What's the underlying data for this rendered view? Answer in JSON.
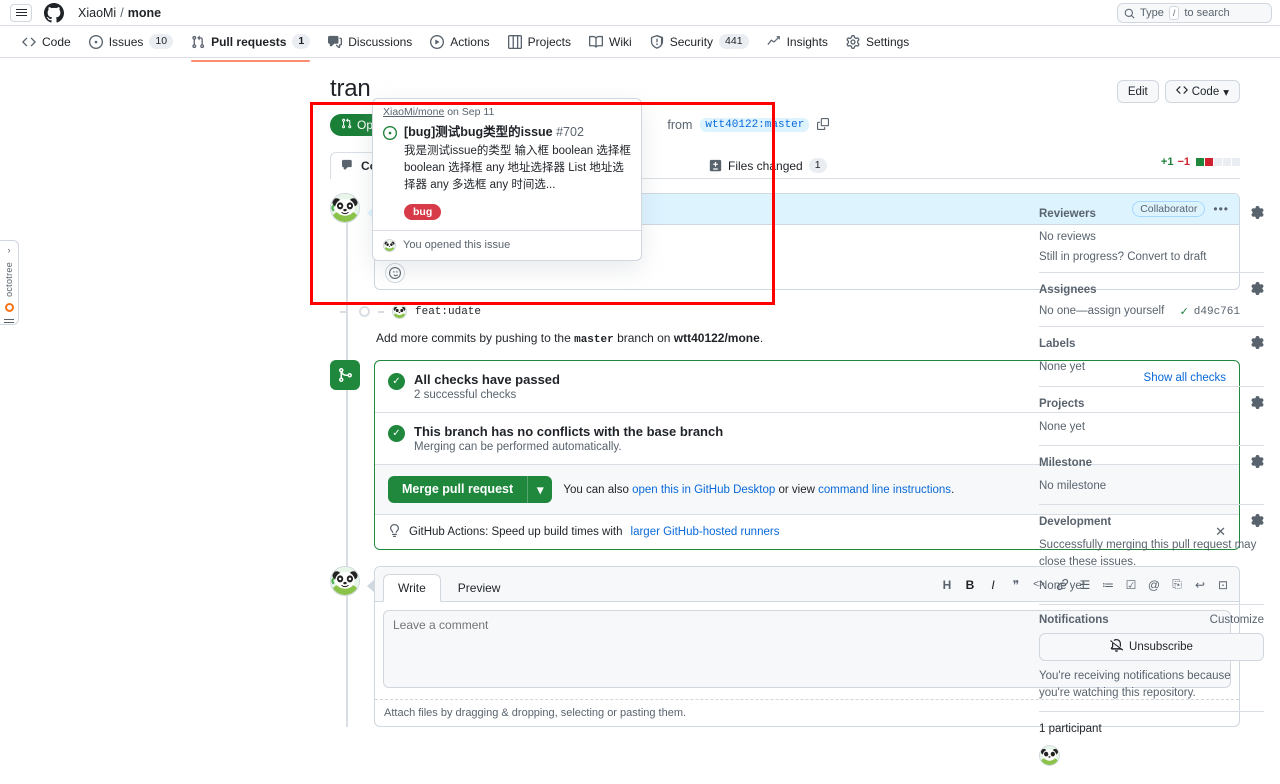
{
  "topbar": {
    "menu_icon": "hamburger-icon",
    "logo": "github-logo",
    "owner": "XiaoMi",
    "separator": "/",
    "repo": "mone",
    "search_placeholder": "Type",
    "search_kbd": "/",
    "search_suffix": "to search"
  },
  "repo_nav": [
    {
      "label": "Code",
      "icon": "code-icon",
      "count": null,
      "active": false
    },
    {
      "label": "Issues",
      "icon": "issue-icon",
      "count": "10",
      "active": false
    },
    {
      "label": "Pull requests",
      "icon": "pull-request-icon",
      "count": "1",
      "active": true
    },
    {
      "label": "Discussions",
      "icon": "discussion-icon",
      "count": null,
      "active": false
    },
    {
      "label": "Actions",
      "icon": "play-icon",
      "count": null,
      "active": false
    },
    {
      "label": "Projects",
      "icon": "table-icon",
      "count": null,
      "active": false
    },
    {
      "label": "Wiki",
      "icon": "book-icon",
      "count": null,
      "active": false
    },
    {
      "label": "Security",
      "icon": "shield-icon",
      "count": "441",
      "active": false
    },
    {
      "label": "Insights",
      "icon": "graph-icon",
      "count": null,
      "active": false
    },
    {
      "label": "Settings",
      "icon": "gear-icon",
      "count": null,
      "active": false
    }
  ],
  "octotree": {
    "label": "octotree",
    "expand_icon": "chevron-right-icon"
  },
  "pr": {
    "title": "tran",
    "edit_label": "Edit",
    "code_label": "Code",
    "state": "Open",
    "meta_suffix": "from",
    "head_branch": "wtt40122:master",
    "copy_icon": "copy-icon",
    "tabs": [
      {
        "label": "Co",
        "icon": "comment-icon",
        "count": null,
        "active": true
      },
      {
        "label": "Files changed",
        "icon": "diff-icon",
        "count": "1",
        "active": false
      }
    ],
    "diff_added": "+1",
    "diff_removed": "−1"
  },
  "comment": {
    "role_badge": "Collaborator",
    "kebab": "•••",
    "body_ref": "#702",
    "reaction_icon": "emoji-icon"
  },
  "commit": {
    "avatar": "panda-avatar",
    "message": "feat:udate",
    "check_icon": "check-icon",
    "sha": "d49c761"
  },
  "push_note": {
    "prefix": "Add more commits by pushing to the",
    "branch": "master",
    "middle": "branch on",
    "repo": "wtt40122/mone",
    "suffix": "."
  },
  "merge": {
    "icon": "merge-icon",
    "checks": [
      {
        "title": "All checks have passed",
        "sub": "2 successful checks",
        "action": "Show all checks"
      },
      {
        "title": "This branch has no conflicts with the base branch",
        "sub": "Merging can be performed automatically.",
        "action": null
      }
    ],
    "merge_button": "Merge pull request",
    "caret_icon": "chevron-down-icon",
    "note_prefix": "You can also",
    "note_link1": "open this in GitHub Desktop",
    "note_middle": "or view",
    "note_link2": "command line instructions",
    "note_suffix": ".",
    "tip_icon": "lightbulb-icon",
    "tip_prefix": "GitHub Actions: Speed up build times with",
    "tip_link": "larger GitHub-hosted runners",
    "tip_close": "close-icon"
  },
  "editor": {
    "avatar": "panda-avatar",
    "tabs": [
      {
        "label": "Write",
        "active": true
      },
      {
        "label": "Preview",
        "active": false
      }
    ],
    "toolbar": [
      {
        "name": "heading-icon",
        "glyph": "H"
      },
      {
        "name": "bold-icon",
        "glyph": "B"
      },
      {
        "name": "italic-icon",
        "glyph": "I"
      },
      {
        "name": "quote-icon",
        "glyph": "❞"
      },
      {
        "name": "code-icon",
        "glyph": "<>"
      },
      {
        "name": "link-icon",
        "glyph": "🔗"
      },
      {
        "name": "unordered-list-icon",
        "glyph": "☰"
      },
      {
        "name": "ordered-list-icon",
        "glyph": "≔"
      },
      {
        "name": "task-list-icon",
        "glyph": "☑"
      },
      {
        "name": "mention-icon",
        "glyph": "@"
      },
      {
        "name": "reference-icon",
        "glyph": "⎘"
      },
      {
        "name": "reply-icon",
        "glyph": "↩"
      },
      {
        "name": "saved-replies-icon",
        "glyph": "⊡"
      }
    ],
    "placeholder": "Leave a comment",
    "attach_note": "Attach files by dragging & dropping, selecting or pasting them."
  },
  "hovercard": {
    "source_repo": "XiaoMi/mone",
    "date": "on Sep 11",
    "issue_icon": "open-issue-icon",
    "title": "[bug]测试bug类型的issue",
    "number": "#702",
    "description": "我是测试issue的类型 输入框 boolean 选择框 boolean 选择框 any 地址选择器 List 地址选择器 any 多选框 any 时间选...",
    "label": "bug",
    "label_color": "#d73a49",
    "footer_avatar": "panda-avatar",
    "footer_text": "You opened this issue"
  },
  "sidebar": [
    {
      "name": "reviewers",
      "title": "Reviewers",
      "gear": true,
      "lines": [
        "No reviews"
      ],
      "link_line": {
        "muted": "Still in progress?",
        "link": "Convert to draft"
      }
    },
    {
      "name": "assignees",
      "title": "Assignees",
      "gear": true,
      "lines": [],
      "link_line": {
        "muted": "No one—",
        "link": "assign yourself"
      }
    },
    {
      "name": "labels",
      "title": "Labels",
      "gear": true,
      "lines": [
        "None yet"
      ],
      "link_line": null
    },
    {
      "name": "projects",
      "title": "Projects",
      "gear": true,
      "lines": [
        "None yet"
      ],
      "link_line": null
    },
    {
      "name": "milestone",
      "title": "Milestone",
      "gear": true,
      "lines": [
        "No milestone"
      ],
      "link_line": null
    },
    {
      "name": "development",
      "title": "Development",
      "gear": true,
      "lines": [
        "Successfully merging this pull request may close these issues.",
        "None yet"
      ],
      "link_line": null
    }
  ],
  "notifications": {
    "title": "Notifications",
    "customize": "Customize",
    "button": "Unsubscribe",
    "bell_icon": "bell-slash-icon",
    "note": "You're receiving notifications because you're watching this repository."
  },
  "participants": {
    "count_label": "1 participant",
    "avatar": "panda-avatar"
  }
}
